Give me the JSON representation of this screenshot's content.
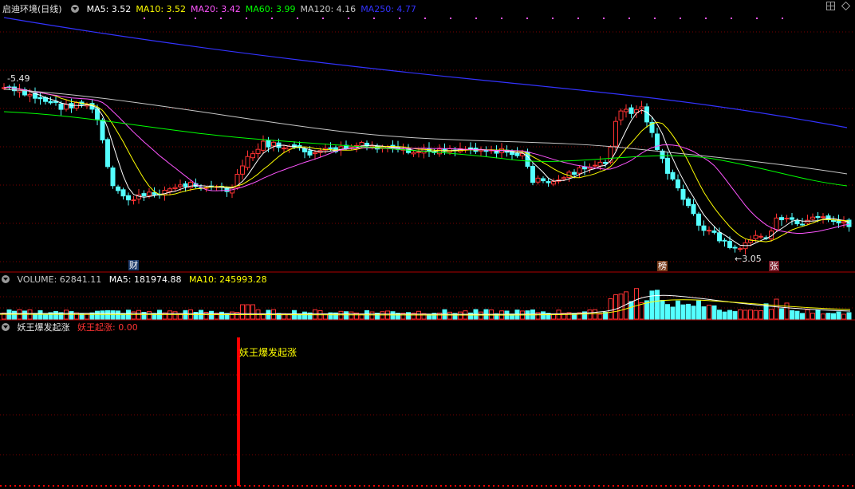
{
  "price_panel": {
    "collapse_icon": "chevron-down-icon",
    "title": "启迪环境(日线)",
    "indicators": [
      {
        "label": "MA5: 3.52",
        "color": "#ffffff"
      },
      {
        "label": "MA10: 3.52",
        "color": "#ffff00"
      },
      {
        "label": "MA20: 3.42",
        "color": "#ff55ff"
      },
      {
        "label": "MA60: 3.99",
        "color": "#00ff00"
      },
      {
        "label": "MA120: 4.16",
        "color": "#c8c8c8"
      },
      {
        "label": "MA250: 4.77",
        "color": "#3333ff"
      }
    ],
    "high_label": "5.49",
    "low_label": "3.05",
    "markers": {
      "cai": "财",
      "bang": "榜",
      "zhang": "张"
    },
    "window_icons": [
      "window-grid-icon",
      "diamond-icon"
    ]
  },
  "volume_panel": {
    "title": "VOLUME: 62841.11",
    "ma5": "MA5: 181974.88",
    "ma10": "MA10: 245993.28",
    "colors": {
      "title": "#c8c8c8",
      "ma5": "#ffffff",
      "ma10": "#ffff00"
    }
  },
  "signal_panel": {
    "title": "妖王爆发起涨",
    "value_label": "妖王起涨: 0.00",
    "annotation": "妖王爆发起涨",
    "colors": {
      "value": "#ff3333",
      "annotation": "#ffff00",
      "bar": "#ff0000"
    }
  },
  "chart_data": {
    "type": "candlestick",
    "price_high": 5.49,
    "price_low": 3.05,
    "ma_current": {
      "MA5": 3.52,
      "MA10": 3.52,
      "MA20": 3.42,
      "MA60": 3.99,
      "MA120": 4.16,
      "MA250": 4.77
    },
    "volume_current": 62841.11,
    "volume_ma5": 181974.88,
    "volume_ma10": 245993.28,
    "signal_value": 0.0
  },
  "colors": {
    "up": "#ff3232",
    "down": "#54ffff",
    "grid": "#7a0000",
    "separator": "#b00000"
  }
}
